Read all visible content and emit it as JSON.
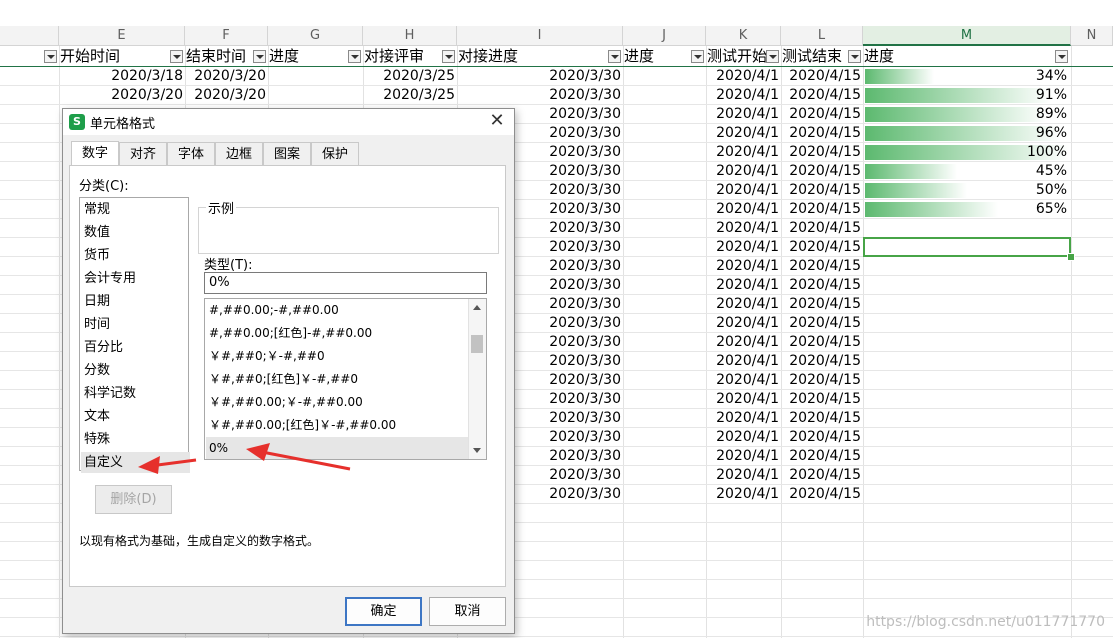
{
  "sheet": {
    "columns": [
      "E",
      "F",
      "G",
      "H",
      "I",
      "J",
      "K",
      "L",
      "M",
      "N"
    ],
    "headers": {
      "E": "开始时间",
      "F": "结束时间",
      "G": "进度",
      "H": "对接评审",
      "I": "对接进度",
      "J": "进度",
      "K": "测试开始",
      "L": "测试结束",
      "M": "进度"
    },
    "row1": {
      "E": "2020/3/18",
      "F": "2020/3/20",
      "H": "2020/3/25",
      "I": "2020/3/30",
      "K": "2020/4/1",
      "L": "2020/4/15"
    },
    "row2": {
      "E": "2020/3/20",
      "F": "2020/3/20",
      "H": "2020/3/25",
      "I": "2020/3/30",
      "K": "2020/4/1",
      "L": "2020/4/15"
    },
    "repeat": {
      "I": "2020/3/30",
      "K": "2020/4/1",
      "L": "2020/4/15"
    },
    "progress": [
      {
        "label": "34%",
        "value": 0.34
      },
      {
        "label": "91%",
        "value": 0.91
      },
      {
        "label": "89%",
        "value": 0.89
      },
      {
        "label": "96%",
        "value": 0.96
      },
      {
        "label": "100%",
        "value": 1.0
      },
      {
        "label": "45%",
        "value": 0.45
      },
      {
        "label": "50%",
        "value": 0.5
      },
      {
        "label": "65%",
        "value": 0.65
      }
    ],
    "bar_color": "#5cb96f",
    "accent": "#217346"
  },
  "dialog": {
    "title": "单元格格式",
    "close_glyph": "✕",
    "logo_letter": "S",
    "tabs": [
      "数字",
      "对齐",
      "字体",
      "边框",
      "图案",
      "保护"
    ],
    "category_label": "分类(C):",
    "categories": [
      "常规",
      "数值",
      "货币",
      "会计专用",
      "日期",
      "时间",
      "百分比",
      "分数",
      "科学记数",
      "文本",
      "特殊",
      "自定义"
    ],
    "sample_label": "示例",
    "type_label": "类型(T):",
    "type_value": "0%",
    "formats": [
      "#,##0.00;-#,##0.00",
      "#,##0.00;[红色]-#,##0.00",
      "￥#,##0;￥-#,##0",
      "￥#,##0;[红色]￥-#,##0",
      "￥#,##0.00;￥-#,##0.00",
      "￥#,##0.00;[红色]￥-#,##0.00",
      "0%"
    ],
    "delete_label": "删除(D)",
    "description": "以现有格式为基础，生成自定义的数字格式。",
    "ok_label": "确定",
    "cancel_label": "取消"
  },
  "watermark": "https://blog.csdn.net/u011771770"
}
